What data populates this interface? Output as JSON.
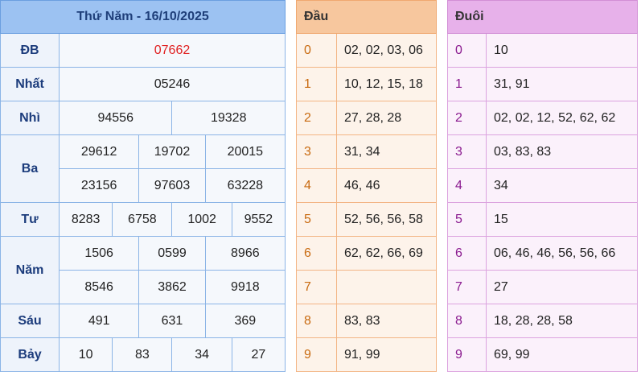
{
  "colors": {
    "results_header_bg": "#9cc2f2",
    "special_prize_text": "#e02020",
    "head_header_bg": "#f7c79e",
    "tail_header_bg": "#e7b1ea"
  },
  "results": {
    "title": "Thứ Năm - 16/10/2025",
    "prizes": [
      {
        "label": "ĐB",
        "numbers": [
          "07662"
        ]
      },
      {
        "label": "Nhất",
        "numbers": [
          "05246"
        ]
      },
      {
        "label": "Nhì",
        "numbers": [
          "94556",
          "19328"
        ]
      },
      {
        "label": "Ba",
        "numbers": [
          "29612",
          "19702",
          "20015",
          "23156",
          "97603",
          "63228"
        ]
      },
      {
        "label": "Tư",
        "numbers": [
          "8283",
          "6758",
          "1002",
          "9552"
        ]
      },
      {
        "label": "Năm",
        "numbers": [
          "1506",
          "0599",
          "8966",
          "8546",
          "3862",
          "9918"
        ]
      },
      {
        "label": "Sáu",
        "numbers": [
          "491",
          "631",
          "369"
        ]
      },
      {
        "label": "Bảy",
        "numbers": [
          "10",
          "83",
          "34",
          "27"
        ]
      }
    ]
  },
  "head": {
    "title": "Đầu",
    "rows": [
      {
        "digit": "0",
        "values": "02, 02, 03, 06"
      },
      {
        "digit": "1",
        "values": "10, 12, 15, 18"
      },
      {
        "digit": "2",
        "values": "27, 28, 28"
      },
      {
        "digit": "3",
        "values": "31, 34"
      },
      {
        "digit": "4",
        "values": "46, 46"
      },
      {
        "digit": "5",
        "values": "52, 56, 56, 58"
      },
      {
        "digit": "6",
        "values": "62, 62, 66, 69"
      },
      {
        "digit": "7",
        "values": ""
      },
      {
        "digit": "8",
        "values": "83, 83"
      },
      {
        "digit": "9",
        "values": "91, 99"
      }
    ]
  },
  "tail": {
    "title": "Đuôi",
    "rows": [
      {
        "digit": "0",
        "values": "10"
      },
      {
        "digit": "1",
        "values": "31, 91"
      },
      {
        "digit": "2",
        "values": "02, 02, 12, 52, 62, 62"
      },
      {
        "digit": "3",
        "values": "03, 83, 83"
      },
      {
        "digit": "4",
        "values": "34"
      },
      {
        "digit": "5",
        "values": "15"
      },
      {
        "digit": "6",
        "values": "06, 46, 46, 56, 56, 66"
      },
      {
        "digit": "7",
        "values": "27"
      },
      {
        "digit": "8",
        "values": "18, 28, 28, 58"
      },
      {
        "digit": "9",
        "values": "69, 99"
      }
    ]
  }
}
